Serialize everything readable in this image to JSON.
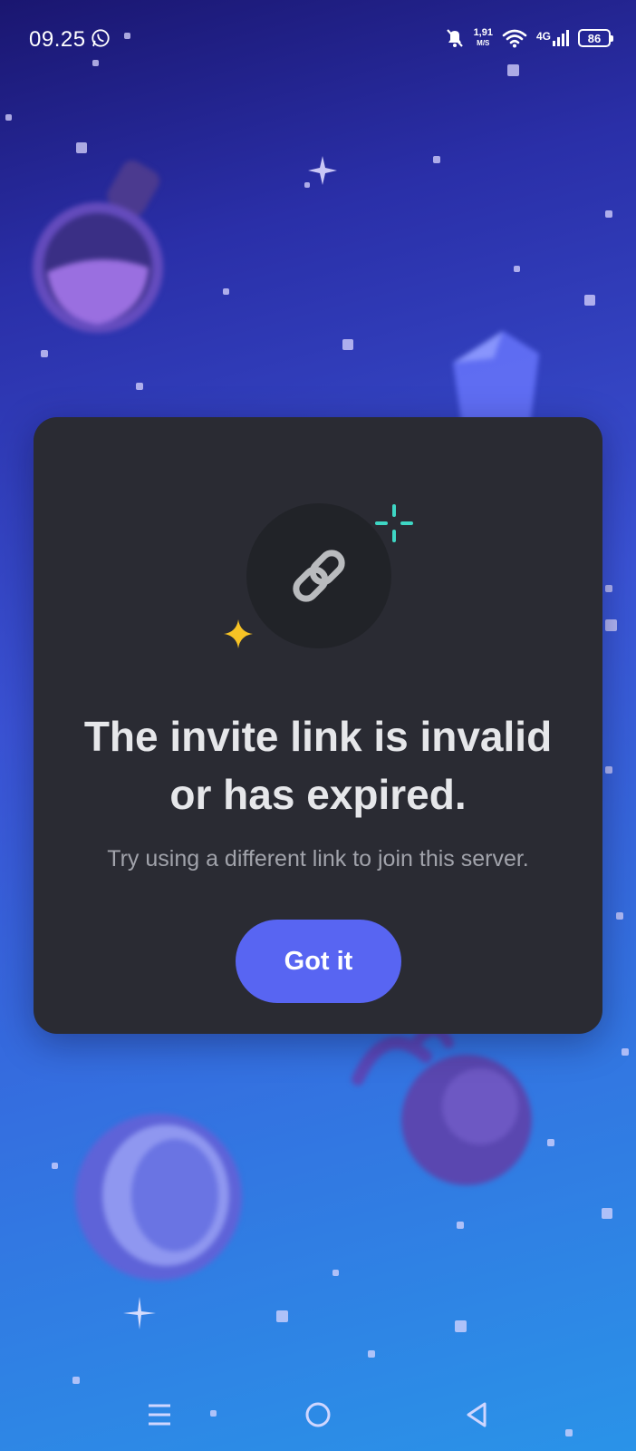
{
  "status_bar": {
    "time": "09.25",
    "net_speed_value": "1,91",
    "net_speed_unit": "M/S",
    "network_type": "4G",
    "battery": "86",
    "icons": [
      "whatsapp-icon",
      "bell-off-icon",
      "wifi-icon",
      "signal-icon",
      "battery-icon"
    ]
  },
  "dialog": {
    "icon": "link-icon",
    "title": "The invite link is invalid\nor has expired.",
    "subtitle": "Try using a different link to join this server.",
    "button_label": "Got it"
  },
  "nav_bar": {
    "icons": [
      "menu-icon",
      "home-icon",
      "back-icon"
    ]
  },
  "colors": {
    "accent": "#5865f2",
    "card_bg": "#2a2b33",
    "icon_bg": "#212328",
    "sparkle_teal": "#3ed6c4",
    "sparkle_yellow": "#f7c325"
  }
}
